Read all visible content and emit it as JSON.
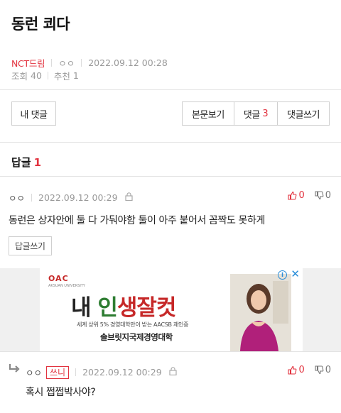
{
  "post": {
    "title": "동런 쾨다",
    "board": "NCT드림",
    "author": "ㅇㅇ",
    "datetime": "2022.09.12 00:28",
    "views_label": "조회",
    "views": "40",
    "recommend_label": "추천",
    "recommend": "1"
  },
  "actions": {
    "my_comments": "내 댓글",
    "view_original": "본문보기",
    "comments_label": "댓글",
    "comments_count": "3",
    "write_comment": "댓글쓰기"
  },
  "replies": {
    "title": "답글",
    "count": "1"
  },
  "comments": [
    {
      "author": "ㅇㅇ",
      "datetime": "2022.09.12 00:29",
      "text": "동런은 상자안에 둘 다 가둬야함 둘이 아주 붙어서 꼼짝도 못하게",
      "up": "0",
      "down": "0",
      "reply_button": "답글쓰기"
    },
    {
      "author": "ㅇㅇ",
      "badge": "쓰니",
      "datetime": "2022.09.12 00:29",
      "text": "혹시 쩝쩝박사야?",
      "up": "0",
      "down": "0"
    }
  ],
  "ad": {
    "logo": "OAC",
    "logo_sub": "AKSUAN UNIVERSITY",
    "headline_1": "내 ",
    "headline_2": "인",
    "headline_3": "생잘컷",
    "sub": "세계 상위 5% 경영대학만이 받는 AACSB 재인증",
    "school": "솔브릿지국제경영대학",
    "info_icon": "i",
    "close_icon": "✕"
  },
  "colors": {
    "accent": "#e2333f",
    "muted": "#999999"
  }
}
